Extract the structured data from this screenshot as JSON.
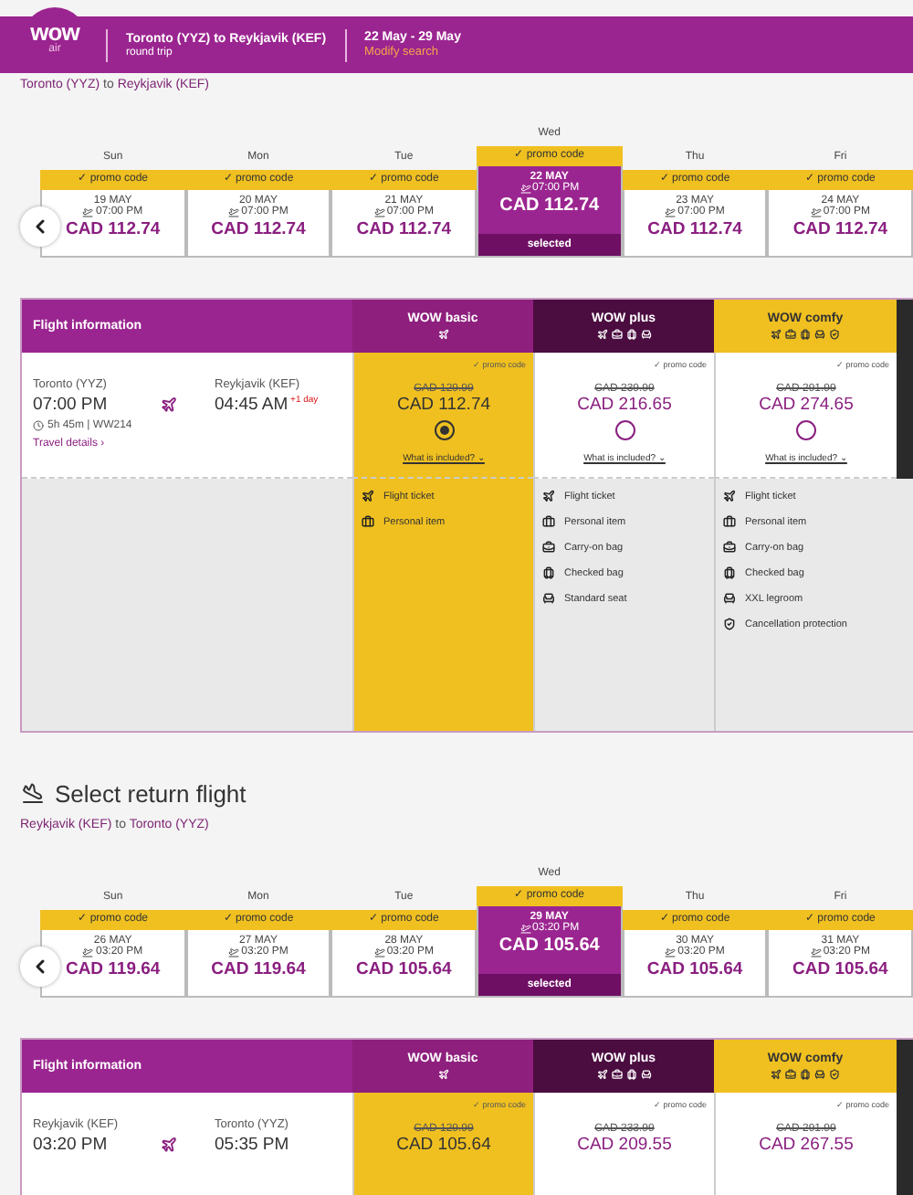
{
  "header": {
    "logo": {
      "text": "wow",
      "sub": "air"
    },
    "route": "Toronto (YYZ) to Reykjavik (KEF)",
    "trip_type": "round trip",
    "dates": "22 May - 29 May",
    "modify_link": "Modify search"
  },
  "legs": [
    {
      "route_from": "Toronto (YYZ)",
      "route_to": "Reykjavik (KEF)",
      "route_sep": "to",
      "days": [
        {
          "day": "Sun",
          "promo": "✓ promo code",
          "date": "19 MAY",
          "time": "07:00 PM",
          "price": "CAD 112.74",
          "selected": false
        },
        {
          "day": "Mon",
          "promo": "✓ promo code",
          "date": "20 MAY",
          "time": "07:00 PM",
          "price": "CAD 112.74",
          "selected": false
        },
        {
          "day": "Tue",
          "promo": "✓ promo code",
          "date": "21 MAY",
          "time": "07:00 PM",
          "price": "CAD 112.74",
          "selected": false
        },
        {
          "day": "Wed",
          "promo": "✓ promo code",
          "date": "22 MAY",
          "time": "07:00 PM",
          "price": "CAD 112.74",
          "selected": true,
          "selected_label": "selected"
        },
        {
          "day": "Thu",
          "promo": "✓ promo code",
          "date": "23 MAY",
          "time": "07:00 PM",
          "price": "CAD 112.74",
          "selected": false
        },
        {
          "day": "Fri",
          "promo": "✓ promo code",
          "date": "24 MAY",
          "time": "07:00 PM",
          "price": "CAD 112.74",
          "selected": false
        }
      ],
      "table": {
        "info_heading": "Flight information",
        "flight": {
          "from": "Toronto (YYZ)",
          "from_time": "07:00 PM",
          "duration": "5h 45m | WW214",
          "details_link": "Travel details ›",
          "to": "Reykjavik (KEF)",
          "to_time": "04:45 AM",
          "next_day": "+1 day"
        },
        "fares": [
          {
            "kind": "basic",
            "name": "WOW basic",
            "promo": "✓ promo code",
            "old_price": "CAD 129.99",
            "price": "CAD 112.74",
            "selected": true,
            "included_link": "What is included? ⌄",
            "features": [
              {
                "kind": "plane",
                "label": "Flight ticket"
              },
              {
                "kind": "personal",
                "label": "Personal item"
              }
            ]
          },
          {
            "kind": "plus",
            "name": "WOW plus",
            "promo": "✓ promo code",
            "old_price": "CAD 239.99",
            "price": "CAD 216.65",
            "selected": false,
            "included_link": "What is included? ⌄",
            "features": [
              {
                "kind": "plane",
                "label": "Flight ticket"
              },
              {
                "kind": "personal",
                "label": "Personal item"
              },
              {
                "kind": "carry",
                "label": "Carry-on bag"
              },
              {
                "kind": "checked",
                "label": "Checked bag"
              },
              {
                "kind": "seat",
                "label": "Standard seat"
              }
            ]
          },
          {
            "kind": "comfy",
            "name": "WOW comfy",
            "promo": "✓ promo code",
            "old_price": "CAD 291.99",
            "price": "CAD 274.65",
            "selected": false,
            "included_link": "What is included? ⌄",
            "features": [
              {
                "kind": "plane",
                "label": "Flight ticket"
              },
              {
                "kind": "personal",
                "label": "Personal item"
              },
              {
                "kind": "carry",
                "label": "Carry-on bag"
              },
              {
                "kind": "checked",
                "label": "Checked bag"
              },
              {
                "kind": "seat",
                "label": "XXL legroom"
              },
              {
                "kind": "shield",
                "label": "Cancellation protection"
              }
            ]
          }
        ]
      }
    },
    {
      "heading": "Select return flight",
      "route_from": "Reykjavik (KEF)",
      "route_to": "Toronto (YYZ)",
      "route_sep": "to",
      "days": [
        {
          "day": "Sun",
          "promo": "✓ promo code",
          "date": "26 MAY",
          "time": "03:20 PM",
          "price": "CAD 119.64",
          "selected": false
        },
        {
          "day": "Mon",
          "promo": "✓ promo code",
          "date": "27 MAY",
          "time": "03:20 PM",
          "price": "CAD 119.64",
          "selected": false
        },
        {
          "day": "Tue",
          "promo": "✓ promo code",
          "date": "28 MAY",
          "time": "03:20 PM",
          "price": "CAD 105.64",
          "selected": false
        },
        {
          "day": "Wed",
          "promo": "✓ promo code",
          "date": "29 MAY",
          "time": "03:20 PM",
          "price": "CAD 105.64",
          "selected": true,
          "selected_label": "selected"
        },
        {
          "day": "Thu",
          "promo": "✓ promo code",
          "date": "30 MAY",
          "time": "03:20 PM",
          "price": "CAD 105.64",
          "selected": false
        },
        {
          "day": "Fri",
          "promo": "✓ promo code",
          "date": "31 MAY",
          "time": "03:20 PM",
          "price": "CAD 105.64",
          "selected": false
        }
      ],
      "table": {
        "info_heading": "Flight information",
        "flight": {
          "from": "Reykjavik (KEF)",
          "from_time": "03:20 PM",
          "to": "Toronto (YYZ)",
          "to_time": "05:35 PM"
        },
        "fares": [
          {
            "kind": "basic",
            "name": "WOW basic",
            "promo": "✓ promo code",
            "old_price": "CAD 129.99",
            "price": "CAD 105.64",
            "selected": true
          },
          {
            "kind": "plus",
            "name": "WOW plus",
            "promo": "✓ promo code",
            "old_price": "CAD 233.99",
            "price": "CAD 209.55",
            "selected": false
          },
          {
            "kind": "comfy",
            "name": "WOW comfy",
            "promo": "✓ promo code",
            "old_price": "CAD 291.99",
            "price": "CAD 267.55",
            "selected": false
          }
        ]
      }
    }
  ]
}
